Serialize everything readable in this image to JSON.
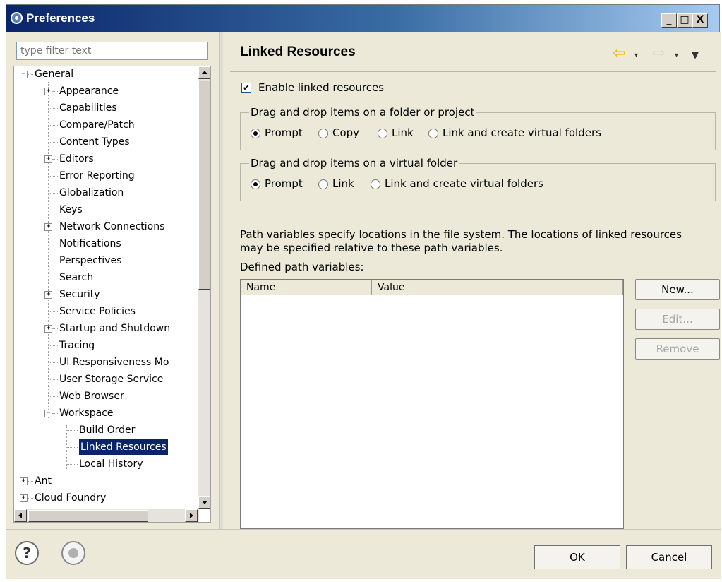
{
  "window": {
    "title": "Preferences",
    "minimize": "_",
    "maximize": "□",
    "close": "X"
  },
  "filter": {
    "placeholder": "type filter text"
  },
  "tree": {
    "general": "General",
    "appearance": "Appearance",
    "capabilities": "Capabilities",
    "compare_patch": "Compare/Patch",
    "content_types": "Content Types",
    "editors": "Editors",
    "error_reporting": "Error Reporting",
    "globalization": "Globalization",
    "keys": "Keys",
    "network_connections": "Network Connections",
    "notifications": "Notifications",
    "perspectives": "Perspectives",
    "search": "Search",
    "security": "Security",
    "service_policies": "Service Policies",
    "startup_shutdown": "Startup and Shutdown",
    "tracing": "Tracing",
    "ui_responsiveness": "UI Responsiveness Mo",
    "user_storage": "User Storage Service",
    "web_browser": "Web Browser",
    "workspace": "Workspace",
    "build_order": "Build Order",
    "linked_resources": "Linked Resources",
    "local_history": "Local History",
    "ant": "Ant",
    "cloud_foundry": "Cloud Foundry",
    "expand_sign": "+",
    "collapse_sign": "−"
  },
  "page": {
    "title": "Linked Resources",
    "enable_linked": {
      "label": "Enable linked resources",
      "checked": true,
      "mark": "✔"
    },
    "group_folder": {
      "title": "Drag and drop items on a folder or project",
      "options": [
        "Prompt",
        "Copy",
        "Link",
        "Link and create virtual folders"
      ],
      "selected": "Prompt"
    },
    "group_virtual": {
      "title": "Drag and drop items on a virtual folder",
      "options": [
        "Prompt",
        "Link",
        "Link and create virtual folders"
      ],
      "selected": "Prompt"
    },
    "description": "Path variables specify locations in the file system. The locations of linked resources may be specified relative to these path variables.",
    "defined_label": "Defined path variables:",
    "table": {
      "columns": [
        "Name",
        "Value"
      ],
      "rows": []
    },
    "buttons": {
      "new": "New...",
      "edit": "Edit...",
      "remove": "Remove"
    }
  },
  "nav": {
    "back": "⇦",
    "forward": "⇨",
    "dropdown": "▾",
    "menu": "▼"
  },
  "footer": {
    "help": "?",
    "ok": "OK",
    "cancel": "Cancel"
  }
}
